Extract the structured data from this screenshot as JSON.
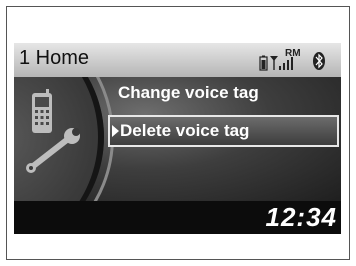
{
  "header": {
    "title": "1 Home",
    "status": {
      "battery_icon": "battery-icon",
      "signal_icon": "signal-icon",
      "roaming_label": "RM",
      "bluetooth_icon": "bluetooth-icon"
    }
  },
  "menu": {
    "items": [
      {
        "label": "Change voice tag",
        "selected": false
      },
      {
        "label": "Delete voice tag",
        "selected": true
      }
    ],
    "context_icons": [
      "phone-icon",
      "wrench-icon"
    ]
  },
  "footer": {
    "clock": "12:34"
  },
  "colors": {
    "header_bg": "#c8c8c8",
    "screen_bg": "#1a1a1a",
    "text": "#ffffff",
    "selection_border": "#e8e8e8"
  }
}
